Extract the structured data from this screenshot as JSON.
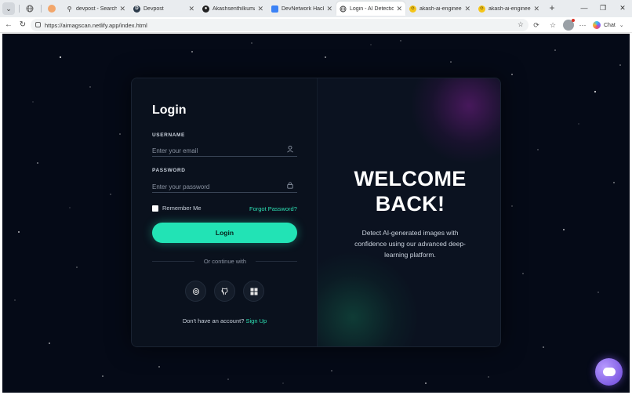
{
  "browser": {
    "tabs": [
      {
        "title": "devpost - Search",
        "favicon": "search-icon"
      },
      {
        "title": "Devpost",
        "favicon": "devpost-icon"
      },
      {
        "title": "Akashsenthilkumar0...",
        "favicon": "github-icon"
      },
      {
        "title": "DevNetwork Hackath...",
        "favicon": "document-icon"
      },
      {
        "title": "Login - AI Detection",
        "favicon": "globe-icon",
        "active": true
      },
      {
        "title": "akash-ai-engineer (A...",
        "favicon": "hf-icon"
      },
      {
        "title": "akash-ai-engineer (A...",
        "favicon": "hf-icon"
      }
    ],
    "url": "https://aimagscan.netlify.app/index.html",
    "chat_label": "Chat"
  },
  "login": {
    "title": "Login",
    "username_label": "USERNAME",
    "username_placeholder": "Enter your email",
    "password_label": "PASSWORD",
    "password_placeholder": "Enter your password",
    "remember_label": "Remember Me",
    "forgot_label": "Forgot Password?",
    "button_label": "Login",
    "divider_text": "Or continue with",
    "social": [
      "google-icon",
      "github-icon",
      "microsoft-icon"
    ],
    "signup_prompt": "Don't have an account?",
    "signup_link": "Sign Up"
  },
  "welcome": {
    "line1": "WELCOME",
    "line2": "BACK!",
    "tagline": "Detect AI-generated images with confidence using our advanced deep-learning platform."
  },
  "colors": {
    "accent": "#22e3b5",
    "background": "#050a17",
    "card": "#0b1220"
  }
}
